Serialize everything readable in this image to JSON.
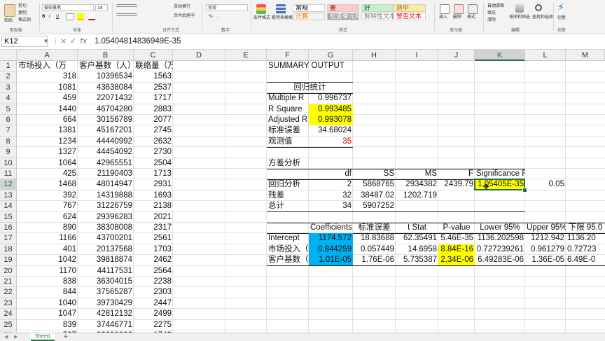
{
  "ribbon": {
    "clipboard": {
      "paste": "粘贴",
      "cut": "剪切",
      "copy": "复制",
      "format_painter": "格式刷",
      "group": "剪贴板"
    },
    "font": {
      "name": "微软雅黑",
      "size": "18",
      "group": "字体",
      "bold": "B",
      "italic": "I",
      "underline": "U"
    },
    "alignment": {
      "wrap": "自动换行",
      "merge": "合并后居中",
      "group": "对齐方式"
    },
    "number": {
      "format": "常规",
      "percent": "%",
      "comma": ",",
      "group": "数字"
    },
    "styles": {
      "conditional": "条件格式",
      "table_format": "套用表格格式",
      "group": "样式",
      "cells": [
        {
          "label": "常规",
          "bg": "#ffffff",
          "fg": "#000000"
        },
        {
          "label": "差",
          "bg": "#ffc7ce",
          "fg": "#9c0006"
        },
        {
          "label": "好",
          "bg": "#c6efce",
          "fg": "#006100"
        },
        {
          "label": "适中",
          "bg": "#ffeb9c",
          "fg": "#9c5700"
        },
        {
          "label": "计算",
          "bg": "#f2f2f2",
          "fg": "#fa7d00"
        },
        {
          "label": "检查单元格",
          "bg": "#a5a5a5",
          "fg": "#ffffff"
        },
        {
          "label": "解释性文本",
          "bg": "#ffffff",
          "fg": "#7f7f7f"
        },
        {
          "label": "警告文本",
          "bg": "#ffffff",
          "fg": "#ff0000"
        }
      ]
    },
    "cells_group": {
      "insert": "插入",
      "delete": "删除",
      "format": "格式",
      "group": "单元格"
    },
    "editing": {
      "autosum": "自动求和",
      "fill": "填充",
      "clear": "清除",
      "sort": "排序和筛选",
      "find": "查找和选择",
      "group": "编辑"
    },
    "ideas": {
      "label": "创意",
      "group": "创意"
    }
  },
  "formula_bar": {
    "name_box": "K12",
    "cancel": "×",
    "enter": "✓",
    "fx": "fx",
    "value": "1.05404814836949E-35"
  },
  "columns": [
    "A",
    "B",
    "C",
    "D",
    "E",
    "F",
    "G",
    "H",
    "I",
    "J",
    "K",
    "L",
    "M"
  ],
  "rows": [
    "1",
    "2",
    "3",
    "4",
    "5",
    "6",
    "7",
    "8",
    "9",
    "10",
    "11",
    "12",
    "13",
    "14",
    "15",
    "16",
    "17",
    "18",
    "19",
    "20",
    "21",
    "22",
    "23",
    "24",
    "25",
    "26"
  ],
  "data_headers": [
    "市场投入（万",
    "客户基数（人）",
    "联络量（万"
  ],
  "data": [
    [
      "318",
      "10396534",
      "1563"
    ],
    [
      "1081",
      "43638084",
      "2537"
    ],
    [
      "459",
      "22071432",
      "1717"
    ],
    [
      "1440",
      "46704280",
      "2883"
    ],
    [
      "664",
      "30156789",
      "2077"
    ],
    [
      "1381",
      "45167201",
      "2745"
    ],
    [
      "1234",
      "44440992",
      "2632"
    ],
    [
      "1327",
      "44454092",
      "2730"
    ],
    [
      "1064",
      "42965551",
      "2504"
    ],
    [
      "425",
      "21190403",
      "1713"
    ],
    [
      "1468",
      "48014947",
      "2931"
    ],
    [
      "392",
      "14319888",
      "1693"
    ],
    [
      "767",
      "31226759",
      "2138"
    ],
    [
      "624",
      "29396283",
      "2021"
    ],
    [
      "890",
      "38308008",
      "2317"
    ],
    [
      "1166",
      "43700201",
      "2561"
    ],
    [
      "401",
      "20137568",
      "1703"
    ],
    [
      "1042",
      "39818874",
      "2462"
    ],
    [
      "1170",
      "44117531",
      "2564"
    ],
    [
      "838",
      "36304015",
      "2238"
    ],
    [
      "844",
      "37565287",
      "2303"
    ],
    [
      "1040",
      "39730429",
      "2447"
    ],
    [
      "1047",
      "42812132",
      "2499"
    ],
    [
      "839",
      "37446771",
      "2275"
    ],
    [
      "527",
      "22690836",
      "1743"
    ]
  ],
  "summary": {
    "title": "SUMMARY OUTPUT",
    "reg_stats_title": "回归统计",
    "reg_stats": [
      {
        "label": "Multiple R",
        "value": "0.996737"
      },
      {
        "label": "R Square",
        "value": "0.993485"
      },
      {
        "label": "Adjusted R",
        "value": "0.993078"
      },
      {
        "label": "标准误差",
        "value": "34.68024"
      },
      {
        "label": "观测值",
        "value": "35"
      }
    ],
    "anova_title": "方差分析",
    "anova_headers": [
      "df",
      "SS",
      "MS",
      "F",
      "Significance F"
    ],
    "anova_rows": [
      {
        "label": "回归分析",
        "values": [
          "2",
          "5868765",
          "2934382",
          "2439.79",
          "1.05405E-35"
        ]
      },
      {
        "label": "残差",
        "values": [
          "32",
          "38487.02",
          "1202.719",
          "",
          ""
        ]
      },
      {
        "label": "总计",
        "values": [
          "34",
          "5907252",
          "",
          "",
          ""
        ]
      }
    ],
    "l12_value": "0.05",
    "coef_headers": [
      "Coefficients",
      "标准误差",
      "t Stat",
      "P-value",
      "Lower 95%",
      "Upper 95%",
      "下限 95.0"
    ],
    "coef_rows": [
      {
        "label": "Intercept",
        "values": [
          "1174.572",
          "18.83688",
          "62.35491",
          "5.46E-35",
          "1136.202598",
          "1212.942",
          "1136.20"
        ]
      },
      {
        "label": "市场投入（万",
        "values": [
          "0.844259",
          "0.057449",
          "14.6958",
          "8.84E-16",
          "0.727239261",
          "0.961279",
          "0.72723"
        ]
      },
      {
        "label": "客户基数（人",
        "values": [
          "1.01E-05",
          "1.76E-06",
          "5.735387",
          "2.34E-06",
          "6.49283E-06",
          "1.36E-05",
          "6.49E-0"
        ]
      }
    ]
  },
  "sheet_tabs": {
    "active": "Sheet1",
    "add": "+",
    "prev": "◀",
    "next": "▶"
  },
  "colors": {
    "highlight_yellow": "#ffff00",
    "highlight_blue": "#00b0f0",
    "accent_green": "#217346",
    "obs_red": "#e00000"
  }
}
